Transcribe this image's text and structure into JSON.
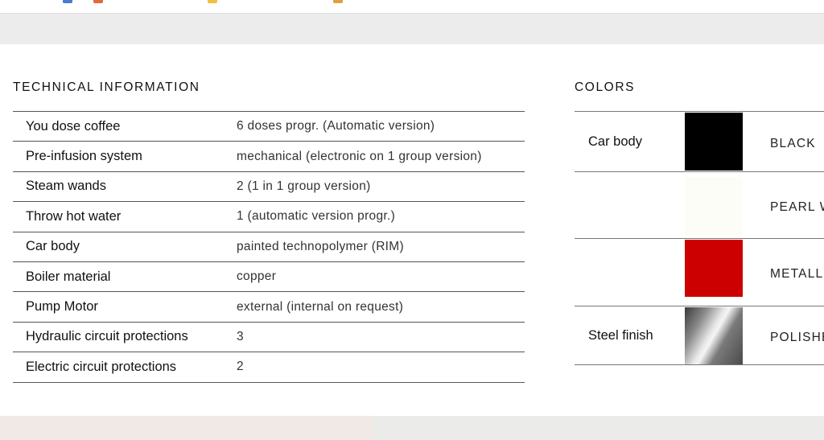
{
  "technical": {
    "title": "TECHNICAL INFORMATION",
    "rows": [
      {
        "label": "You dose coffee",
        "value": "6 doses progr. (Automatic version)"
      },
      {
        "label": "Pre-infusion system",
        "value": "mechanical (electronic on 1 group version)"
      },
      {
        "label": "Steam wands",
        "value": "2 (1 in 1 group version)"
      },
      {
        "label": "Throw hot water",
        "value": "1 (automatic version progr.)"
      },
      {
        "label": "Car body",
        "value": "painted technopolymer (RIM)"
      },
      {
        "label": "Boiler material",
        "value": "copper"
      },
      {
        "label": "Pump Motor",
        "value": "external (internal on request)"
      },
      {
        "label": "Hydraulic circuit protections",
        "value": "3"
      },
      {
        "label": "Electric circuit protections",
        "value": "2"
      }
    ]
  },
  "colors": {
    "title": "COLORS",
    "rows": [
      {
        "label": "Car body",
        "name": "BLACK",
        "swatch": "#000000"
      },
      {
        "label": "",
        "name": "PEARL W",
        "swatch": "#fdfdf7"
      },
      {
        "label": "",
        "name": "METALL",
        "swatch": "#cc0000"
      },
      {
        "label": "Steel finish",
        "name": "POLISHE",
        "swatch": "polished-steel"
      }
    ]
  }
}
